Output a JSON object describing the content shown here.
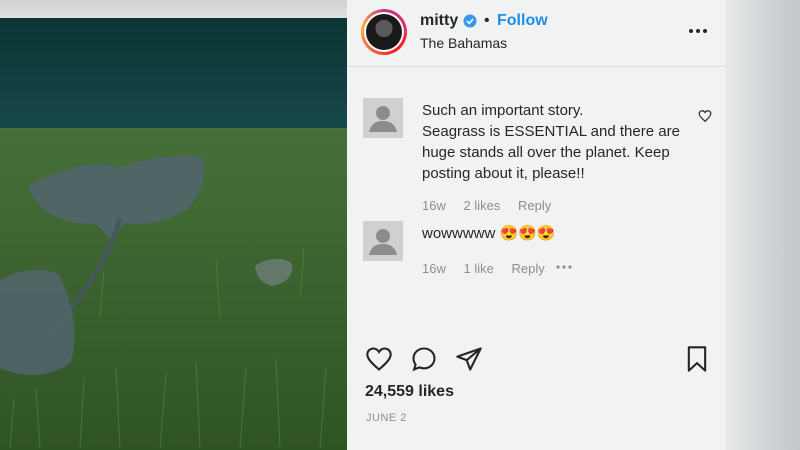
{
  "post": {
    "username": "mitty",
    "separator": "•",
    "follow_label": "Follow",
    "location": "The Bahamas",
    "likes": "24,559 likes",
    "date": "JUNE 2",
    "comments": [
      {
        "lines": [
          "Such an important story.",
          "Seagrass is ESSENTIAL and there are",
          "huge stands all over the planet. Keep",
          "posting about it, please!!"
        ],
        "age": "16w",
        "likes": "2 likes",
        "reply": "Reply"
      },
      {
        "lines": [
          "wowwwww 😍😍😍"
        ],
        "age": "16w",
        "likes": "1 like",
        "reply": "Reply"
      }
    ]
  },
  "colors": {
    "follow": "#1e8fe8",
    "meta": "#8e8e8e",
    "text": "#262626"
  },
  "icons": [
    "verified-icon",
    "more-options-icon",
    "heart-icon",
    "comment-icon",
    "share-icon",
    "bookmark-icon",
    "default-avatar-icon"
  ]
}
